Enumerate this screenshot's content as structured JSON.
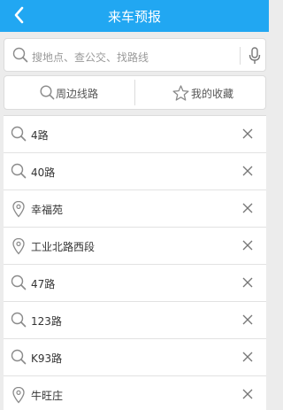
{
  "header": {
    "title": "来车预报"
  },
  "search": {
    "placeholder": "搜地点、查公交、找路线"
  },
  "tabs": [
    {
      "label": "周边线路",
      "icon": "search-icon"
    },
    {
      "label": "我的收藏",
      "icon": "star-icon"
    }
  ],
  "history": [
    {
      "label": "4路",
      "icon": "search-icon"
    },
    {
      "label": "40路",
      "icon": "search-icon"
    },
    {
      "label": "幸福苑",
      "icon": "location-pin-icon"
    },
    {
      "label": "工业北路西段",
      "icon": "location-pin-icon"
    },
    {
      "label": "47路",
      "icon": "search-icon"
    },
    {
      "label": "123路",
      "icon": "search-icon"
    },
    {
      "label": "K93路",
      "icon": "search-icon"
    },
    {
      "label": "牛旺庄",
      "icon": "location-pin-icon"
    }
  ],
  "colors": {
    "header_bg": "#21a7f2",
    "page_bg": "#ececec"
  }
}
